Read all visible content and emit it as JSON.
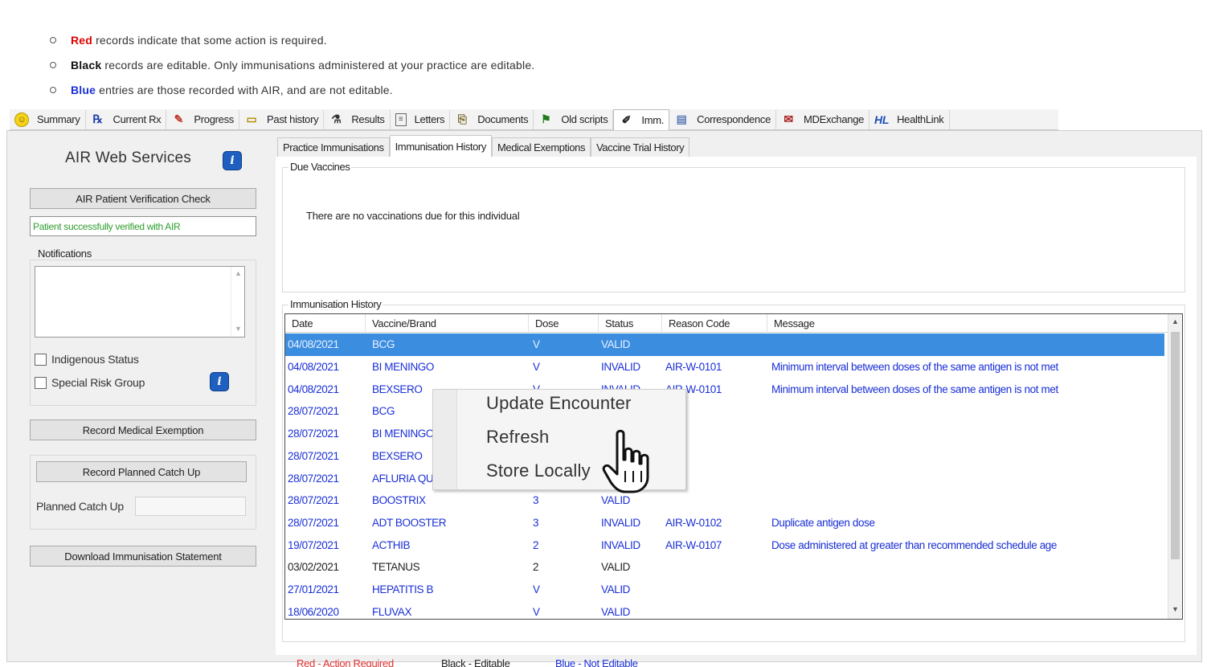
{
  "notes": [
    {
      "keyword": "Red",
      "keyword_color": "#e00000",
      "text": "records indicate that some action is required."
    },
    {
      "keyword": "Black",
      "keyword_color": "#111111",
      "text": "records are editable. Only immunisations administered at your practice are editable."
    },
    {
      "keyword": "Blue",
      "keyword_color": "#1a2fd6",
      "text": "entries are those recorded with AIR, and are not editable."
    }
  ],
  "top_tabs": [
    {
      "icon": "smiley-icon",
      "label": "Summary"
    },
    {
      "icon": "rx-icon",
      "label": "Current Rx"
    },
    {
      "icon": "progress-icon",
      "label": "Progress"
    },
    {
      "icon": "folder-icon",
      "label": "Past history"
    },
    {
      "icon": "flask-icon",
      "label": "Results"
    },
    {
      "icon": "letter-icon",
      "label": "Letters"
    },
    {
      "icon": "paperclip-icon",
      "label": "Documents"
    },
    {
      "icon": "flag-icon",
      "label": "Old scripts"
    },
    {
      "icon": "syringe-icon",
      "label": "Imm."
    },
    {
      "icon": "correspondence-icon",
      "label": "Correspondence"
    },
    {
      "icon": "mail-icon",
      "label": "MDExchange"
    },
    {
      "icon": "healthlink-icon",
      "label": "HealthLink"
    }
  ],
  "active_top_tab": "Imm.",
  "sidebar": {
    "title": "AIR Web Services",
    "verify_button": "AIR Patient Verification Check",
    "verify_status": "Patient successfully verified with AIR",
    "notifications_label": "Notifications",
    "indigenous_label": "Indigenous Status",
    "special_risk_label": "Special Risk Group",
    "exemption_button": "Record Medical Exemption",
    "catch_up_button": "Record Planned Catch Up",
    "planned_catch_up_label": "Planned Catch Up",
    "planned_catch_up_value": "",
    "download_button": "Download Immunisation Statement"
  },
  "sub_tabs": [
    "Practice Immunisations",
    "Immunisation History",
    "Medical Exemptions",
    "Vaccine Trial History"
  ],
  "active_sub_tab": "Immunisation History",
  "due_vaccines": {
    "label": "Due Vaccines",
    "message": "There are no vaccinations due for this individual"
  },
  "history": {
    "label": "Immunisation History",
    "columns": [
      "Date",
      "Vaccine/Brand",
      "Dose",
      "Status",
      "Reason Code",
      "Message"
    ],
    "rows": [
      {
        "date": "04/08/2021",
        "vaccine": "BCG",
        "dose": "V",
        "status": "VALID",
        "reason": "",
        "message": "",
        "color": "blue",
        "selected": true
      },
      {
        "date": "04/08/2021",
        "vaccine": "BI MENINGO",
        "dose": "V",
        "status": "INVALID",
        "reason": "AIR-W-0101",
        "message": "Minimum interval between doses of the same antigen is not met",
        "color": "blue"
      },
      {
        "date": "04/08/2021",
        "vaccine": "BEXSERO",
        "dose": "V",
        "status": "INVALID",
        "reason": "AIR-W-0101",
        "message": "Minimum interval between doses of the same antigen is not met",
        "color": "blue"
      },
      {
        "date": "28/07/2021",
        "vaccine": "BCG",
        "dose": "",
        "status": "",
        "reason": "",
        "message": "",
        "color": "blue"
      },
      {
        "date": "28/07/2021",
        "vaccine": "BI MENINGO",
        "dose": "",
        "status": "",
        "reason": "",
        "message": "",
        "color": "blue"
      },
      {
        "date": "28/07/2021",
        "vaccine": "BEXSERO",
        "dose": "",
        "status": "",
        "reason": "",
        "message": "",
        "color": "blue"
      },
      {
        "date": "28/07/2021",
        "vaccine": "AFLURIA QU",
        "dose": "",
        "status": "",
        "reason": "",
        "message": "",
        "color": "blue"
      },
      {
        "date": "28/07/2021",
        "vaccine": "BOOSTRIX",
        "dose": "3",
        "status": "VALID",
        "reason": "",
        "message": "",
        "color": "blue"
      },
      {
        "date": "28/07/2021",
        "vaccine": "ADT BOOSTER",
        "dose": "3",
        "status": "INVALID",
        "reason": "AIR-W-0102",
        "message": "Duplicate antigen dose",
        "color": "blue"
      },
      {
        "date": "19/07/2021",
        "vaccine": "ACTHIB",
        "dose": "2",
        "status": "INVALID",
        "reason": "AIR-W-0107",
        "message": "Dose administered at greater than recommended schedule age",
        "color": "blue"
      },
      {
        "date": "03/02/2021",
        "vaccine": "TETANUS",
        "dose": "2",
        "status": "VALID",
        "reason": "",
        "message": "",
        "color": "black"
      },
      {
        "date": "27/01/2021",
        "vaccine": "HEPATITIS B",
        "dose": "V",
        "status": "VALID",
        "reason": "",
        "message": "",
        "color": "blue"
      },
      {
        "date": "18/06/2020",
        "vaccine": "FLUVAX",
        "dose": "V",
        "status": "VALID",
        "reason": "",
        "message": "",
        "color": "blue"
      }
    ]
  },
  "legend": [
    {
      "text": "Red - Action Required",
      "color": "#e03030"
    },
    {
      "text": "Black - Editable",
      "color": "#222222"
    },
    {
      "text": "Blue - Not Editable",
      "color": "#1a2fd6"
    }
  ],
  "context_menu": [
    "Update Encounter",
    "Refresh",
    "Store Locally"
  ]
}
